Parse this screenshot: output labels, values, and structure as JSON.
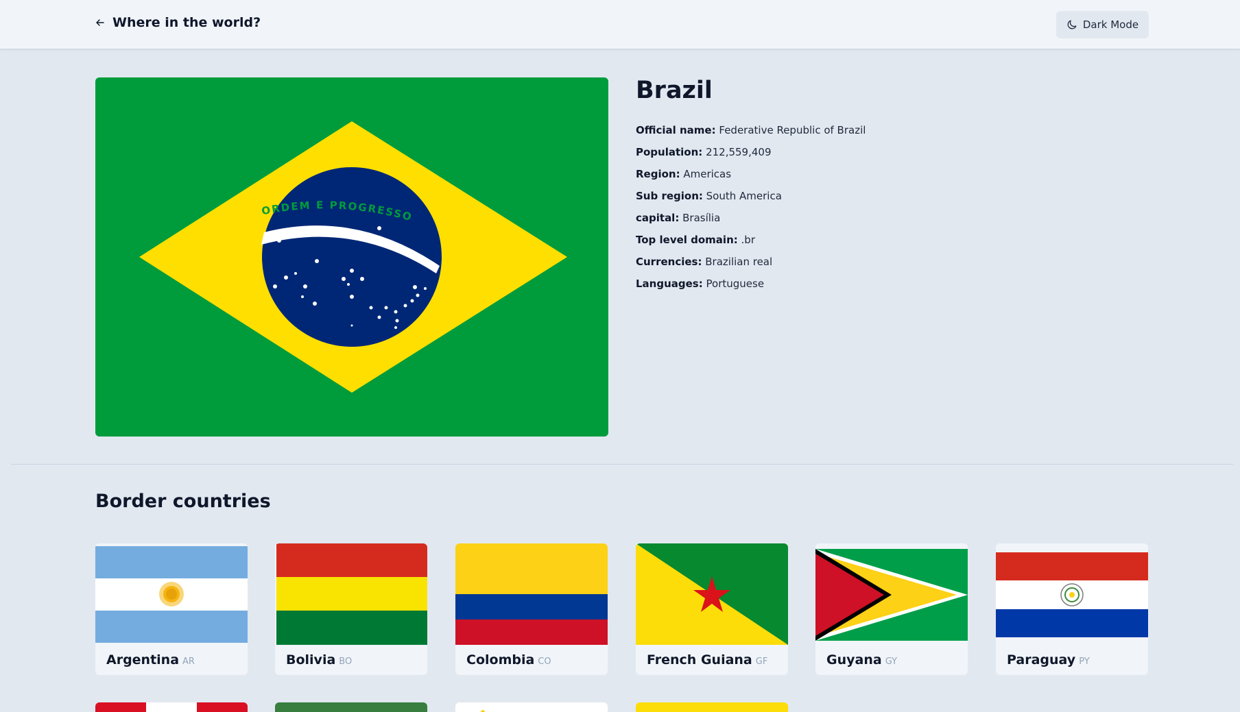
{
  "header": {
    "title": "Where in the world?",
    "dark_mode_label": "Dark Mode"
  },
  "country": {
    "name": "Brazil",
    "details": [
      {
        "label": "Official name:",
        "value": "Federative Republic of Brazil"
      },
      {
        "label": "Population:",
        "value": "212,559,409"
      },
      {
        "label": "Region:",
        "value": "Americas"
      },
      {
        "label": "Sub region:",
        "value": "South America"
      },
      {
        "label": "capital:",
        "value": "Brasília"
      },
      {
        "label": "Top level domain:",
        "value": ".br"
      },
      {
        "label": "Currencies:",
        "value": "Brazilian real"
      },
      {
        "label": "Languages:",
        "value": "Portuguese"
      }
    ],
    "flag_motto": "ORDEM E PROGRESSO"
  },
  "border_section": {
    "title": "Border countries",
    "countries": [
      {
        "name": "Argentina",
        "code": "AR"
      },
      {
        "name": "Bolivia",
        "code": "BO"
      },
      {
        "name": "Colombia",
        "code": "CO"
      },
      {
        "name": "French Guiana",
        "code": "GF"
      },
      {
        "name": "Guyana",
        "code": "GY"
      },
      {
        "name": "Paraguay",
        "code": "PY"
      }
    ]
  },
  "colors": {
    "page_bg": "#e2e8f0",
    "card_bg": "#f1f5f9",
    "brazil_green": "#009c3b",
    "brazil_yellow": "#fedf00",
    "brazil_blue": "#002776"
  }
}
